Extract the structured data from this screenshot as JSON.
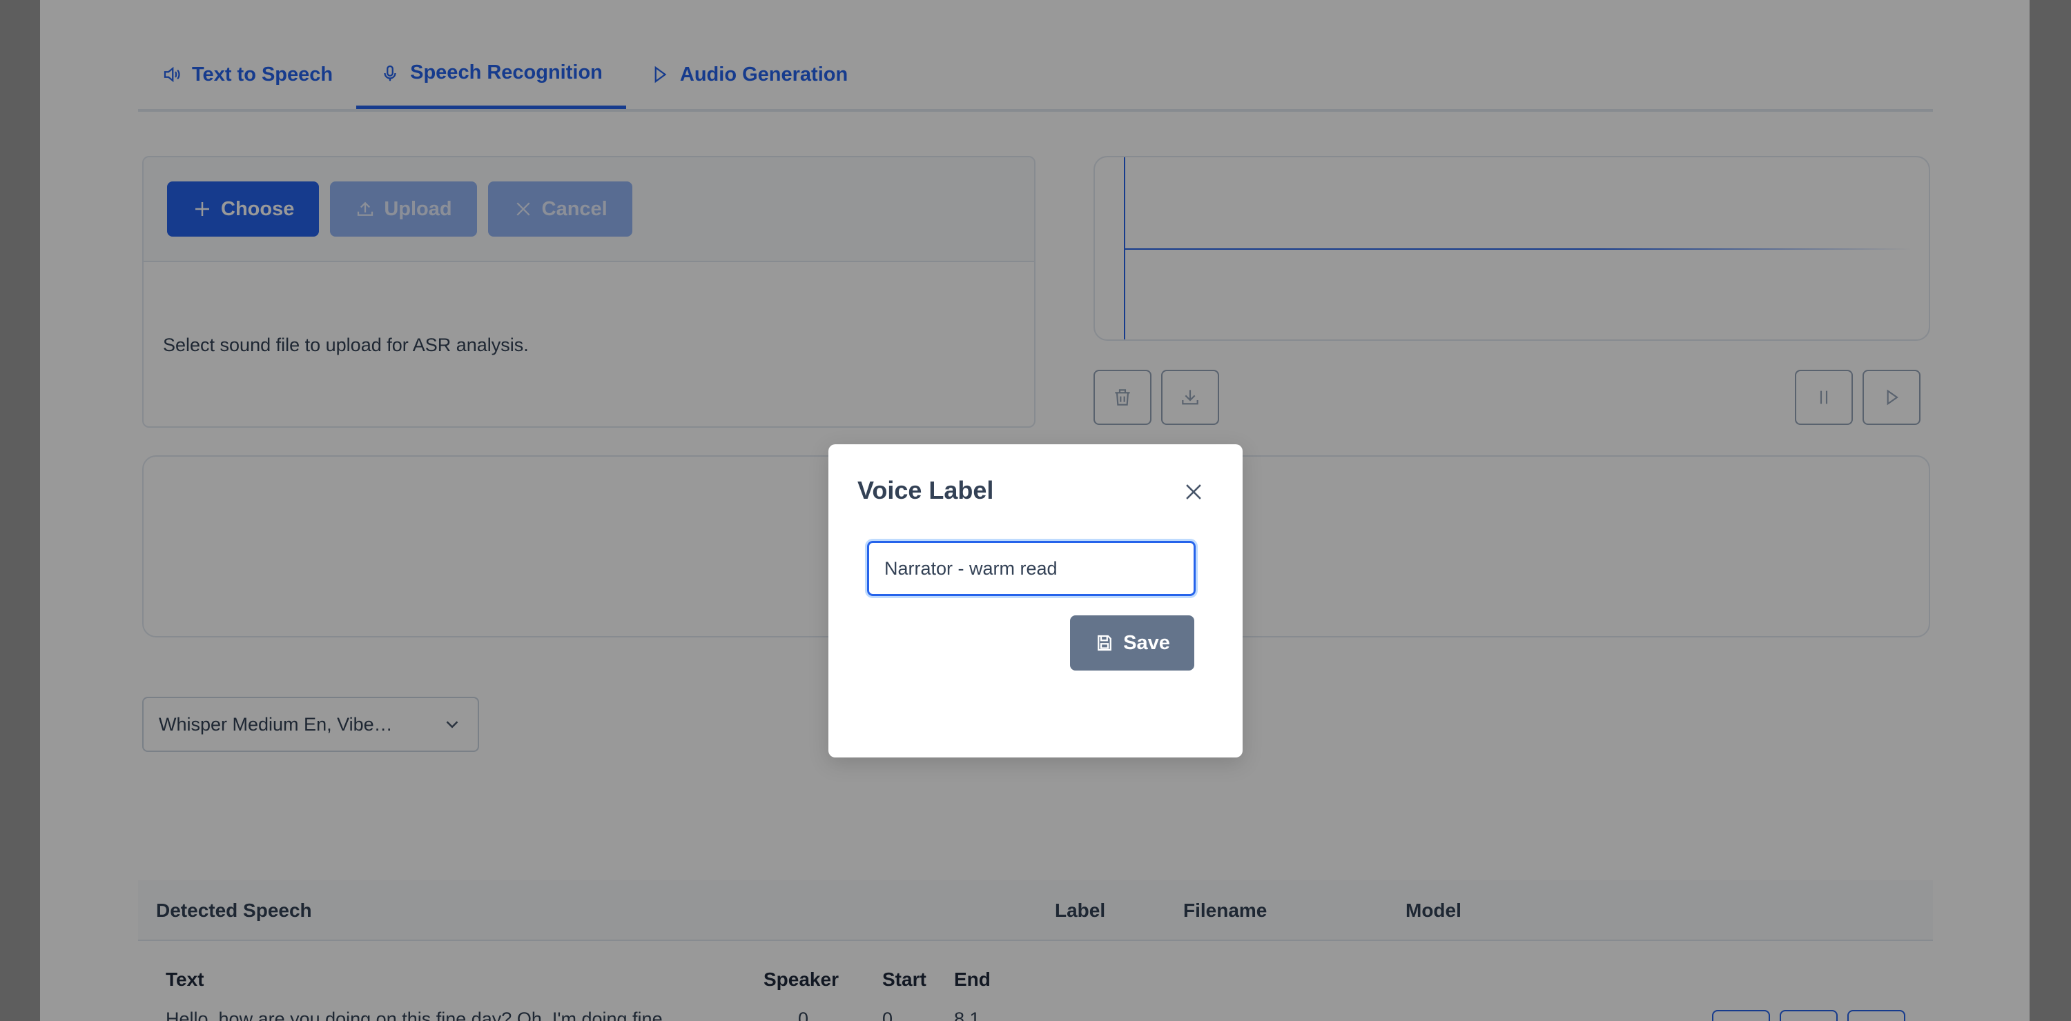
{
  "tabs": [
    {
      "label": "Text to Speech",
      "icon": "speaker-icon"
    },
    {
      "label": "Speech Recognition",
      "icon": "microphone-icon",
      "active": true
    },
    {
      "label": "Audio Generation",
      "icon": "play-icon"
    }
  ],
  "upload": {
    "choose_label": "Choose",
    "upload_label": "Upload",
    "cancel_label": "Cancel",
    "hint": "Select sound file to upload for ASR analysis."
  },
  "model_select": {
    "selected": "Whisper Medium En, Vibe…"
  },
  "table": {
    "headers": [
      "Detected Speech",
      "Label",
      "Filename",
      "Model"
    ],
    "subheaders": [
      "Text",
      "Speaker",
      "Start",
      "End"
    ],
    "row": {
      "text": "Hello, how are you doing on this fine day? Oh, I'm doing fine",
      "speaker": "0",
      "start": "0",
      "end": "8.1"
    }
  },
  "modal": {
    "title": "Voice Label",
    "input_value": "Narrator - warm read",
    "save_label": "Save"
  },
  "colors": {
    "accent": "#2563eb",
    "save_button": "#64748b",
    "overlay": "rgba(0,0,0,0.4)"
  }
}
